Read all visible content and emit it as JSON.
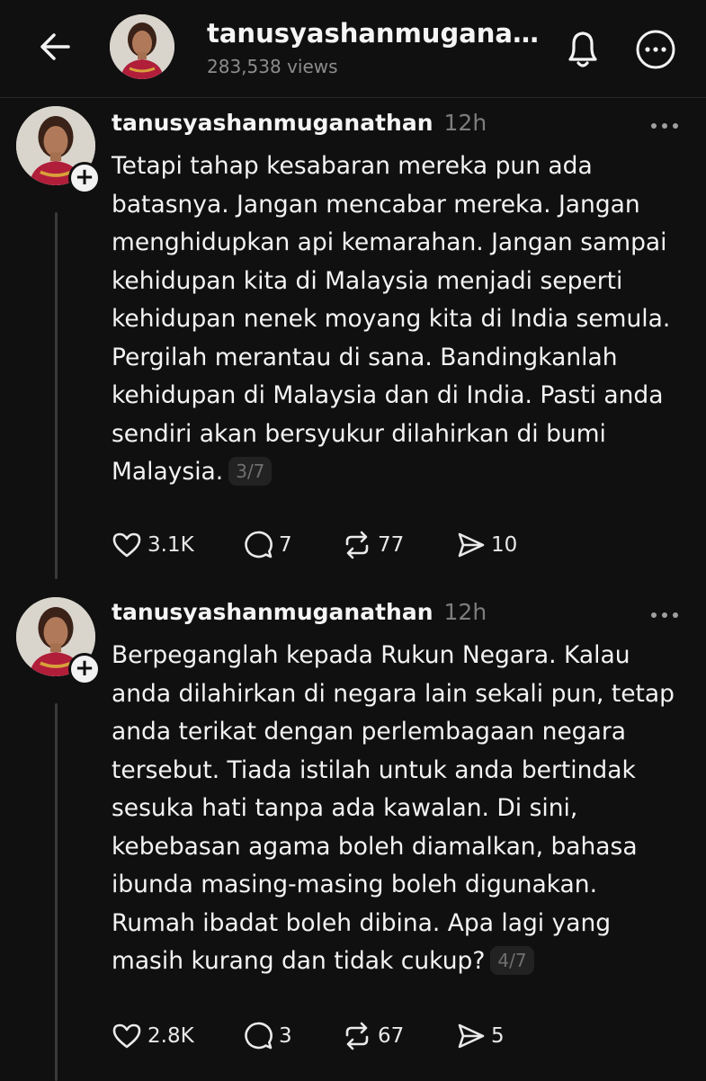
{
  "header": {
    "title": "tanusyashanmugana...",
    "views": "283,538 views"
  },
  "posts": [
    {
      "username": "tanusyashanmuganathan",
      "time": "12h",
      "text": "Tetapi tahap kesabaran mereka pun ada batasnya. Jangan mencabar mereka. Jangan menghidupkan api kemarahan. Jangan sampai kehidupan kita di Malaysia menjadi seperti kehidupan nenek moyang kita di India semula. Pergilah merantau di sana. Bandingkanlah kehidupan di Malaysia dan di India. Pasti anda sendiri akan bersyukur dilahirkan di bumi Malaysia.",
      "counter": "3/7",
      "likes": "3.1K",
      "replies": "7",
      "reposts": "77",
      "shares": "10"
    },
    {
      "username": "tanusyashanmuganathan",
      "time": "12h",
      "text": "Berpeganglah kepada Rukun Negara. Kalau anda dilahirkan di negara lain sekali pun, tetap anda terikat dengan perlembagaan negara tersebut. Tiada istilah untuk anda bertindak sesuka hati tanpa ada kawalan. Di sini, kebebasan agama boleh diamalkan, bahasa ibunda masing-masing boleh digunakan. Rumah ibadat boleh dibina. Apa lagi yang masih kurang dan tidak cukup?",
      "counter": "4/7",
      "likes": "2.8K",
      "replies": "3",
      "reposts": "67",
      "shares": "5"
    }
  ],
  "icons": {
    "back": "arrow-left-icon",
    "bell": "bell-icon",
    "more": "more-circle-icon",
    "follow": "plus-icon",
    "like": "heart-icon",
    "reply": "comment-icon",
    "repost": "repost-icon",
    "share": "send-icon"
  },
  "colors": {
    "background": "#101010",
    "text": "#f3f3f3",
    "muted": "#7d7d7d"
  }
}
